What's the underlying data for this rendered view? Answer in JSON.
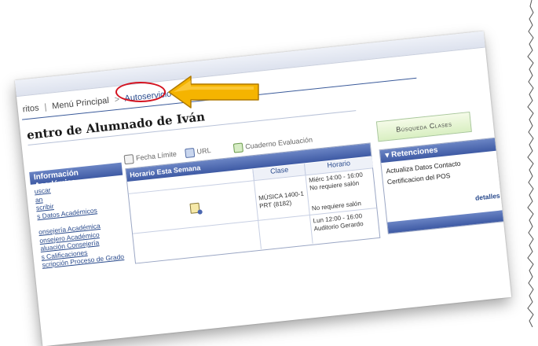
{
  "breadcrumb": {
    "item1": "ritos",
    "item2": "Menú Principal",
    "separator": ">",
    "item3": "Autoservicio"
  },
  "page_title": "entro de Alumnado de Iván",
  "info_section": {
    "header": "Información Académica",
    "links": [
      "uscar",
      "an",
      "scribir",
      "s Datos Académicos",
      "onsejería Académica",
      "onsejero Académico",
      "aluación Consejería",
      "s Calificaciones",
      "scripción Proceso de Grado"
    ]
  },
  "toolbar": {
    "fecha": "Fecha Límite",
    "url": "URL",
    "cuaderno": "Cuaderno Evaluación"
  },
  "schedule": {
    "title": "Horario Esta Semana",
    "col_clase": "Clase",
    "col_horario": "Horario",
    "class_name": "MÚSICA 1400-1",
    "class_code": "PRT (8182)",
    "time1": "Miérc 14:00 - 16:00",
    "room1": "No requiere salón",
    "room2": "No requiere salón",
    "time2": "Lun 12:00 - 16:00",
    "room3": "Auditorio Gerardo"
  },
  "search_button": "Búsqueda Clases",
  "retenciones": {
    "header": "Retenciones",
    "item1": "Actualiza Datos Contacto",
    "item2": "Certificacion del POS",
    "detail": "detalles"
  },
  "colors": {
    "header_blue": "#3e5aa4",
    "arrow_fill": "#f5b400",
    "highlight_red": "#d4121f"
  }
}
